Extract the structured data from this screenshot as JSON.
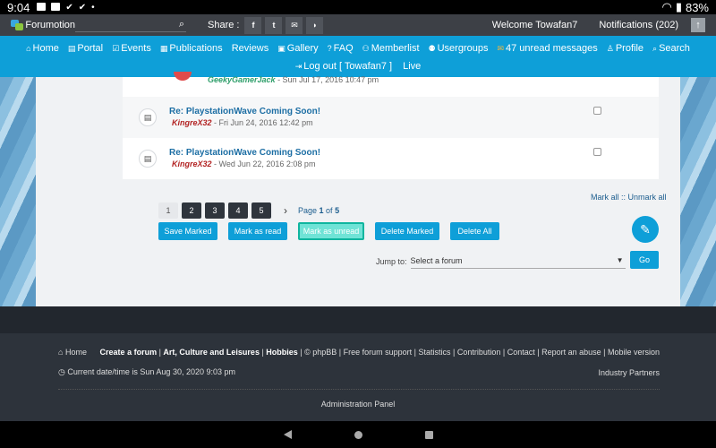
{
  "status": {
    "time": "9:04",
    "battery": "83%"
  },
  "topbar": {
    "logo": "Forumotion",
    "share_label": "Share :",
    "share_buttons": [
      "f",
      "t",
      "✉",
      "rss"
    ],
    "welcome": "Welcome Towafan7",
    "notifications": "Notifications  (202)"
  },
  "nav": {
    "row1": [
      "Home",
      "Portal",
      "Events",
      "Publications",
      "Reviews",
      "Gallery",
      "FAQ",
      "Memberlist",
      "Usergroups",
      "47 unread messages",
      "Profile",
      "Search"
    ],
    "logout": "Log out [ Towafan7 ]",
    "live": "Live"
  },
  "topics": {
    "first": {
      "author": "GeekyGamerJack",
      "date": " - Sun Jul 17, 2016 10:47 pm"
    },
    "items": [
      {
        "title": "Re: PlaystationWave Coming Soon!",
        "author": "KingreX32",
        "date": " - Fri Jun 24, 2016 12:42 pm"
      },
      {
        "title": "Re: PlaystationWave Coming Soon!",
        "author": "KingreX32",
        "date": " - Wed Jun 22, 2016 2:08 pm"
      }
    ]
  },
  "mark_all": "Mark all :: Unmark all",
  "pagination": {
    "pages": [
      "1",
      "2",
      "3",
      "4",
      "5"
    ],
    "label_prefix": "Page ",
    "current": "1",
    "of": " of ",
    "total": "5"
  },
  "actions": {
    "save": "Save Marked",
    "read": "Mark as read",
    "unread": "Mark as unread",
    "delete_marked": "Delete Marked",
    "delete_all": "Delete All"
  },
  "jump": {
    "label": "Jump to:",
    "selected": "Select a forum",
    "go": "Go"
  },
  "footer": {
    "home": "Home",
    "create": "Create a forum",
    "category": "Art, Culture and Leisures",
    "hobbies": "Hobbies",
    "rest": " | © phpBB | Free forum support | Statistics | Contribution | Contact | Report an abuse | Mobile version",
    "datetime": "Current date/time is Sun Aug 30, 2020 9:03 pm",
    "partners": "Industry Partners",
    "admin": "Administration Panel"
  }
}
